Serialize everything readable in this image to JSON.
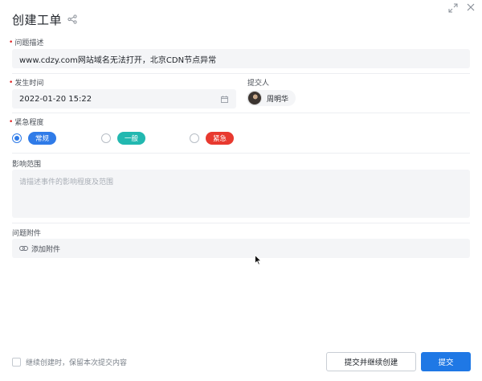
{
  "dialog": {
    "title": "创建工单"
  },
  "problem_description": {
    "label": "问题描述",
    "value": "www.cdzy.com网站域名无法打开，北京CDN节点异常"
  },
  "occurrence_time": {
    "label": "发生时间",
    "value": "2022-01-20 15:22"
  },
  "submitter": {
    "label": "提交人",
    "name": "周明华"
  },
  "urgency": {
    "label": "紧急程度",
    "options": [
      {
        "label": "常规",
        "color": "#2f7be8",
        "selected": true
      },
      {
        "label": "一般",
        "color": "#22b8b0",
        "selected": false
      },
      {
        "label": "紧急",
        "color": "#e8392f",
        "selected": false
      }
    ]
  },
  "impact": {
    "label": "影响范围",
    "placeholder": "请描述事件的影响程度及范围"
  },
  "attachment": {
    "label": "问题附件",
    "add_label": "添加附件"
  },
  "footer": {
    "keep_content_label": "继续创建时，保留本次提交内容",
    "submit_and_continue_label": "提交并继续创建",
    "submit_label": "提交"
  },
  "icons": {
    "share": "share-icon",
    "expand": "expand-icon",
    "close": "close-icon",
    "calendar": "calendar-icon",
    "link": "link-icon"
  }
}
